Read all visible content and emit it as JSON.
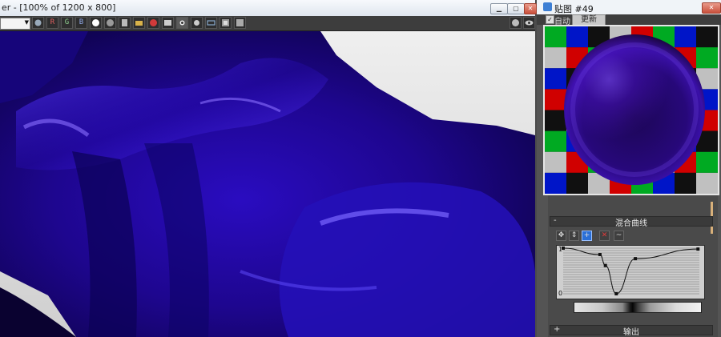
{
  "render_window": {
    "title": "er - [100% of 1200 x 800]",
    "controls": [
      "minimize",
      "restore",
      "close"
    ],
    "channel_buttons": [
      "R",
      "G",
      "B"
    ]
  },
  "map_window": {
    "title": "贴图 #49",
    "auto_label": "自动",
    "auto_checked": true,
    "update_label": "更新"
  },
  "rollouts": {
    "mix_curve_label": "混合曲线",
    "output_label": "输出"
  },
  "curve": {
    "y_max_label": "1",
    "y_min_label": "0",
    "points": [
      [
        0.0,
        1.0
      ],
      [
        0.27,
        0.86
      ],
      [
        0.31,
        0.62
      ],
      [
        0.39,
        0.0
      ],
      [
        0.53,
        0.77
      ],
      [
        0.99,
        0.98
      ]
    ]
  },
  "checker_colors": [
    "#00aa22",
    "#0015c8",
    "#101010",
    "#c0c0c0",
    "#d00000"
  ],
  "accent_color": "#2a0bd0"
}
